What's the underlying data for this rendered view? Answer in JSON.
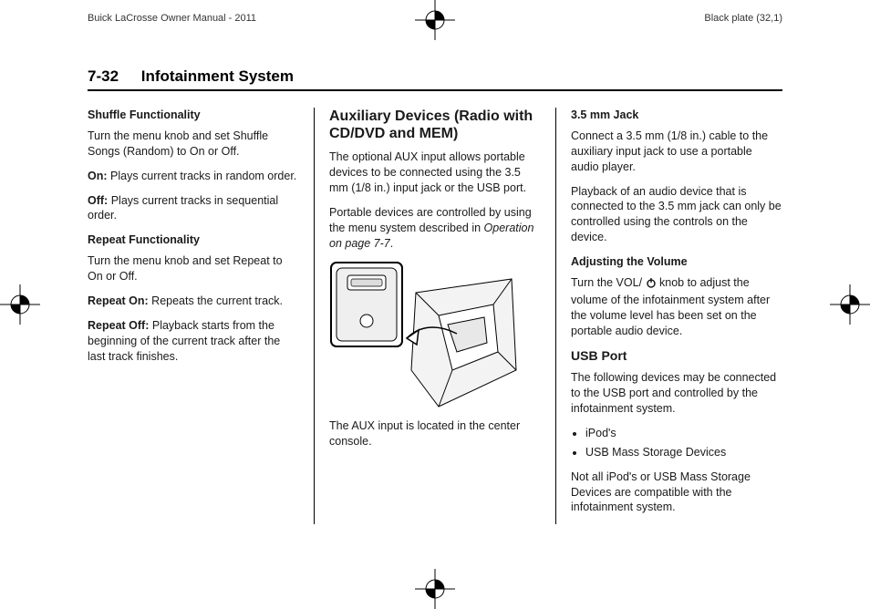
{
  "top": {
    "left": "Buick LaCrosse Owner Manual - 2011",
    "right": "Black plate (32,1)"
  },
  "header": {
    "pageNumber": "7-32",
    "title": "Infotainment System"
  },
  "col1": {
    "shuffleFunctionality": {
      "heading": "Shuffle Functionality",
      "intro": "Turn the menu knob and set Shuffle Songs (Random) to On or Off.",
      "onLabel": "On:",
      "onText": "Plays current tracks in random order.",
      "offLabel": "Off:",
      "offText": "Plays current tracks in sequential order."
    },
    "repeatFunctionality": {
      "heading": "Repeat Functionality",
      "intro": "Turn the menu knob and set Repeat to On or Off.",
      "repeatOnLabel": "Repeat On:",
      "repeatOnText": "Repeats the current track.",
      "repeatOffLabel": "Repeat Off:",
      "repeatOffText": "Playback starts from the beginning of the current track after the last track finishes."
    }
  },
  "col2": {
    "heading": "Auxiliary Devices (Radio with CD/DVD and MEM)",
    "p1": "The optional AUX input allows portable devices to be connected using the 3.5 mm (1/8 in.) input jack or the USB port.",
    "p2a": "Portable devices are controlled by using the menu system described in ",
    "p2italic": "Operation on page 7‑7",
    "p2b": ".",
    "caption": "The AUX input is located in the center console."
  },
  "col3": {
    "jack": {
      "heading": "3.5 mm Jack",
      "p1": "Connect a 3.5 mm (1/8 in.) cable to the auxiliary input jack to use a portable audio player.",
      "p2": "Playback of an audio device that is connected to the 3.5 mm jack can only be controlled using the controls on the device."
    },
    "volume": {
      "heading": "Adjusting the Volume",
      "p_a": "Turn the VOL/ ",
      "p_b": " knob to adjust the volume of the infotainment system after the volume level has been set on the portable audio device."
    },
    "usb": {
      "heading": "USB Port",
      "intro": "The following devices may be connected to the USB port and controlled by the infotainment system.",
      "items": [
        "iPod's",
        "USB Mass Storage Devices"
      ],
      "note": "Not all iPod's or USB Mass Storage Devices are compatible with the infotainment system."
    }
  }
}
